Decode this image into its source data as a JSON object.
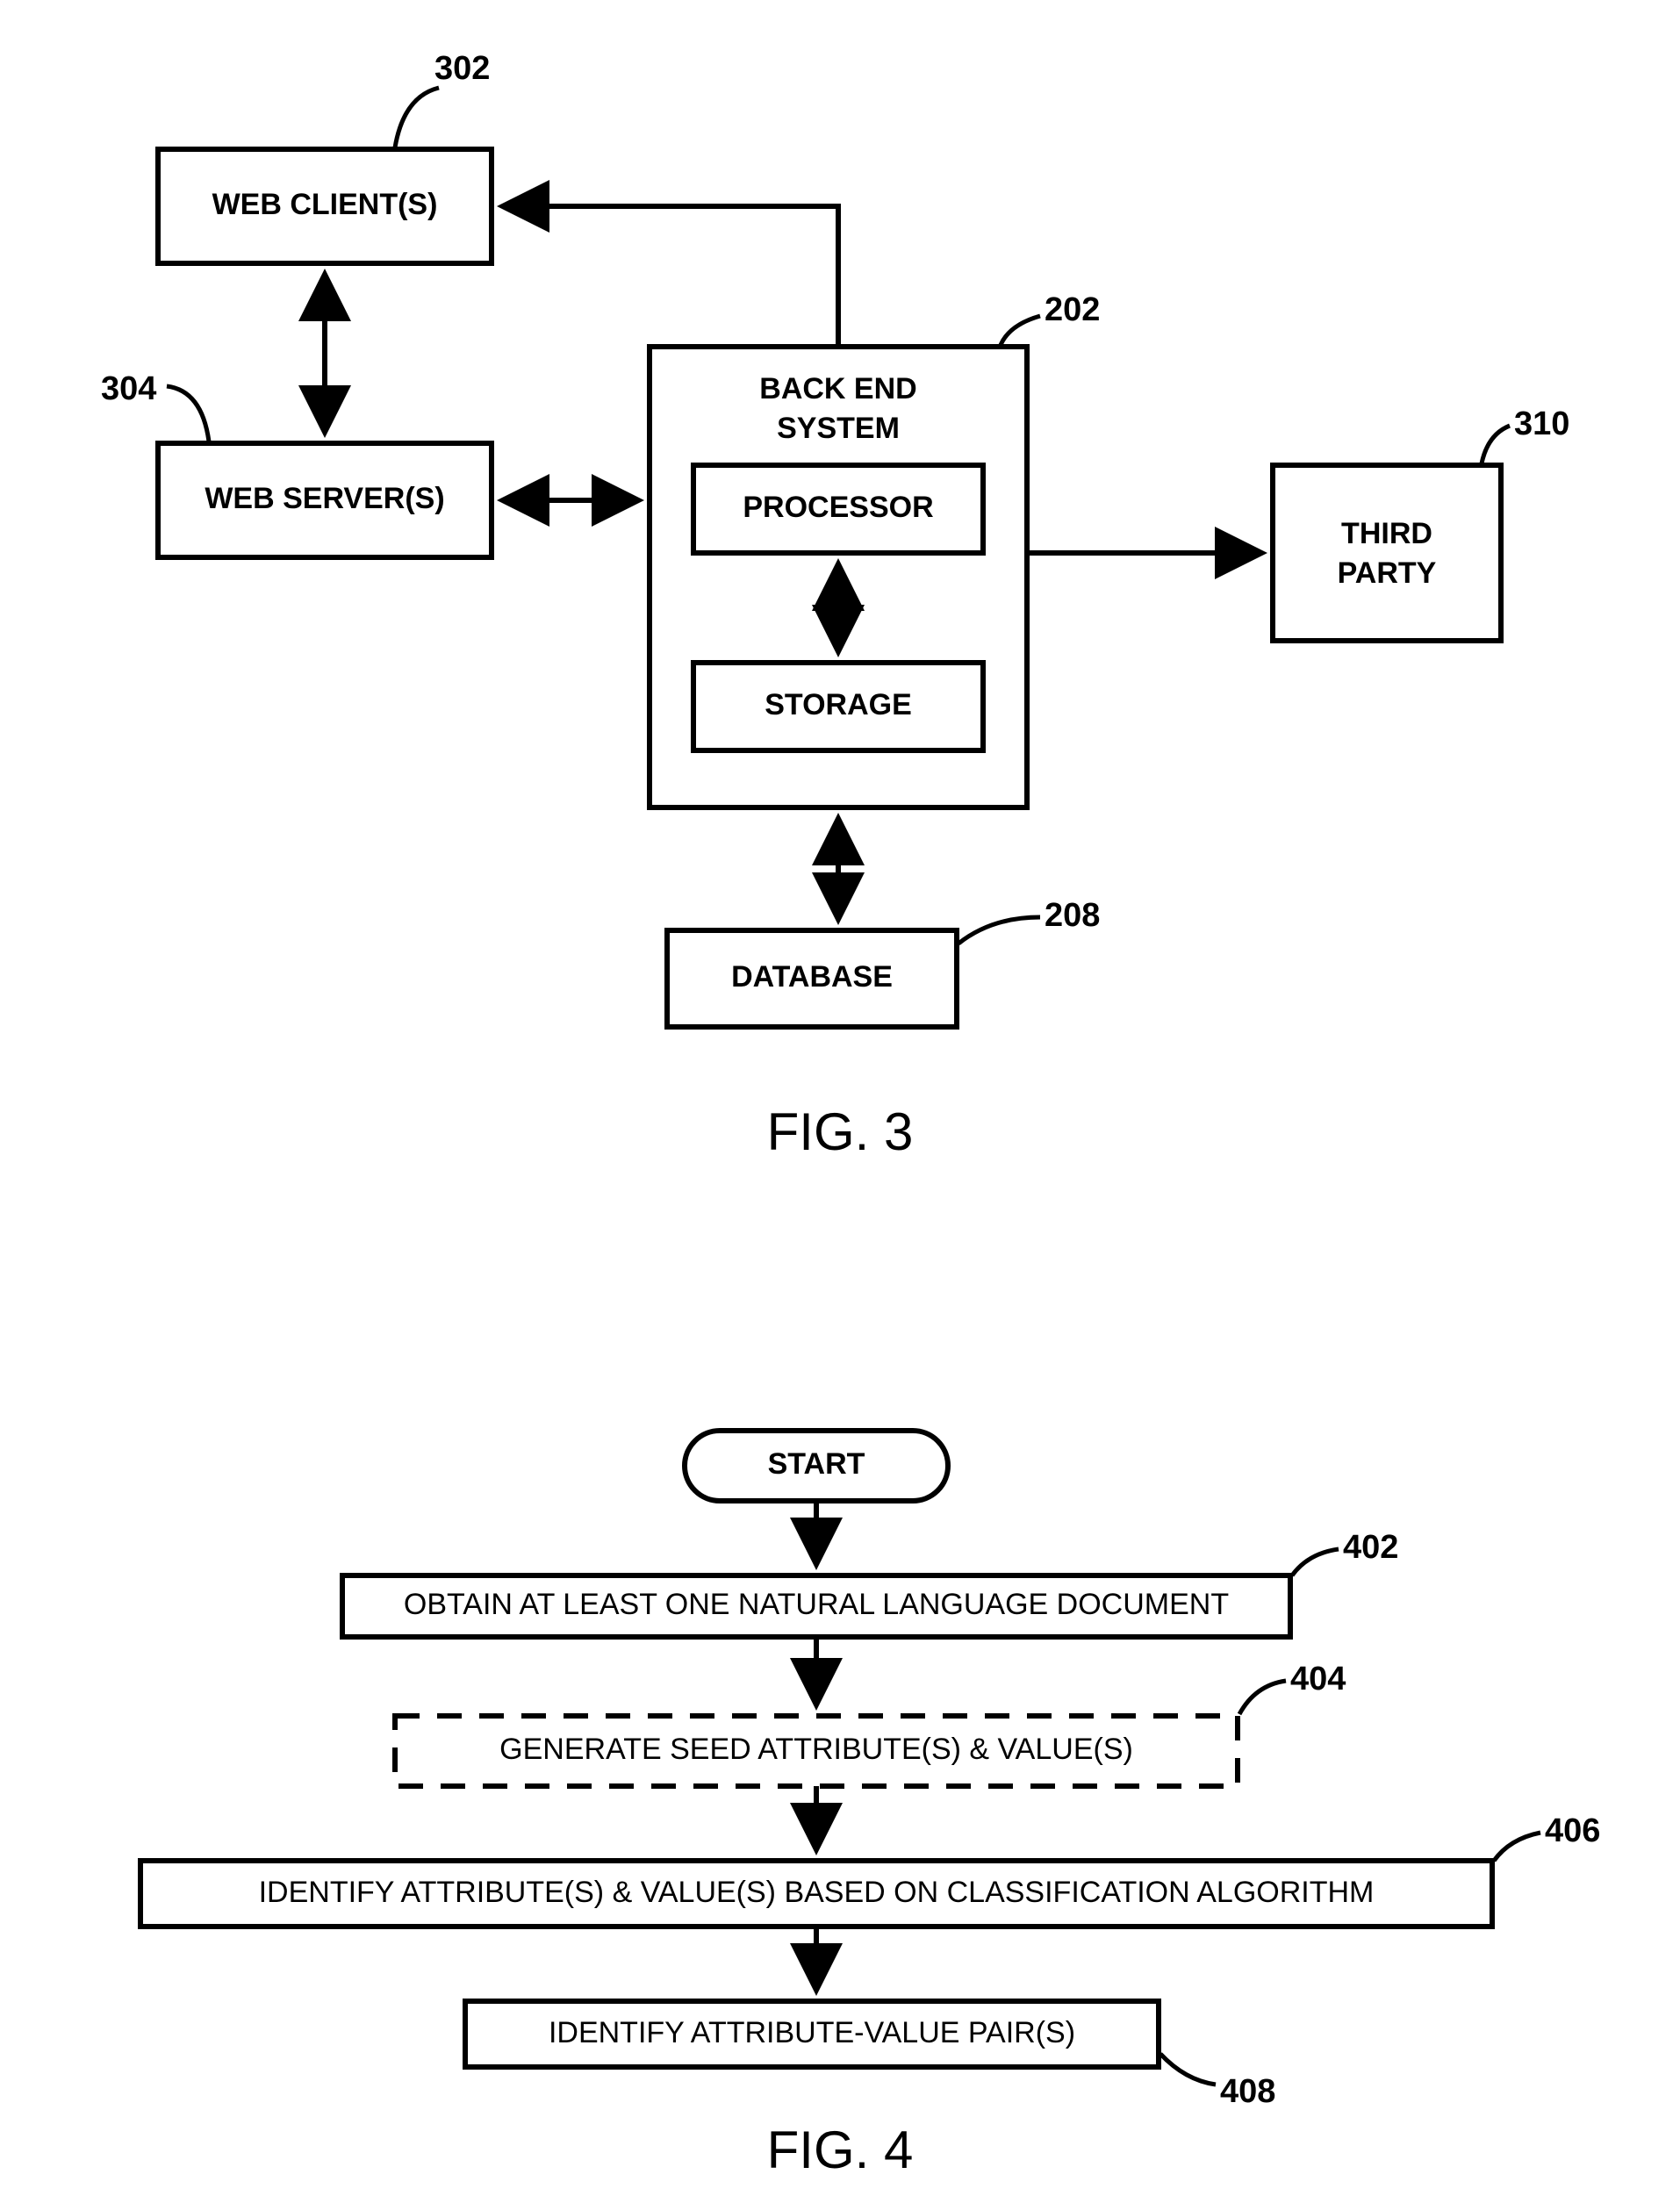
{
  "fig3": {
    "label": "FIG. 3",
    "boxes": {
      "web_client": {
        "text": "WEB CLIENT(S)",
        "ref": "302"
      },
      "web_server": {
        "text": "WEB SERVER(S)",
        "ref": "304"
      },
      "backend": {
        "text": "BACK END SYSTEM",
        "ref": "202"
      },
      "processor": {
        "text": "PROCESSOR"
      },
      "storage": {
        "text": "STORAGE"
      },
      "third_party": {
        "text": "THIRD PARTY",
        "ref": "310"
      },
      "database": {
        "text": "DATABASE",
        "ref": "208"
      }
    }
  },
  "fig4": {
    "label": "FIG. 4",
    "start": "START",
    "steps": {
      "s402": {
        "text": "OBTAIN AT LEAST ONE NATURAL LANGUAGE DOCUMENT",
        "ref": "402"
      },
      "s404": {
        "text": "GENERATE SEED ATTRIBUTE(S) & VALUE(S)",
        "ref": "404"
      },
      "s406": {
        "text": "IDENTIFY ATTRIBUTE(S) & VALUE(S) BASED ON CLASSIFICATION ALGORITHM",
        "ref": "406"
      },
      "s408": {
        "text": "IDENTIFY ATTRIBUTE-VALUE PAIR(S)",
        "ref": "408"
      }
    }
  }
}
